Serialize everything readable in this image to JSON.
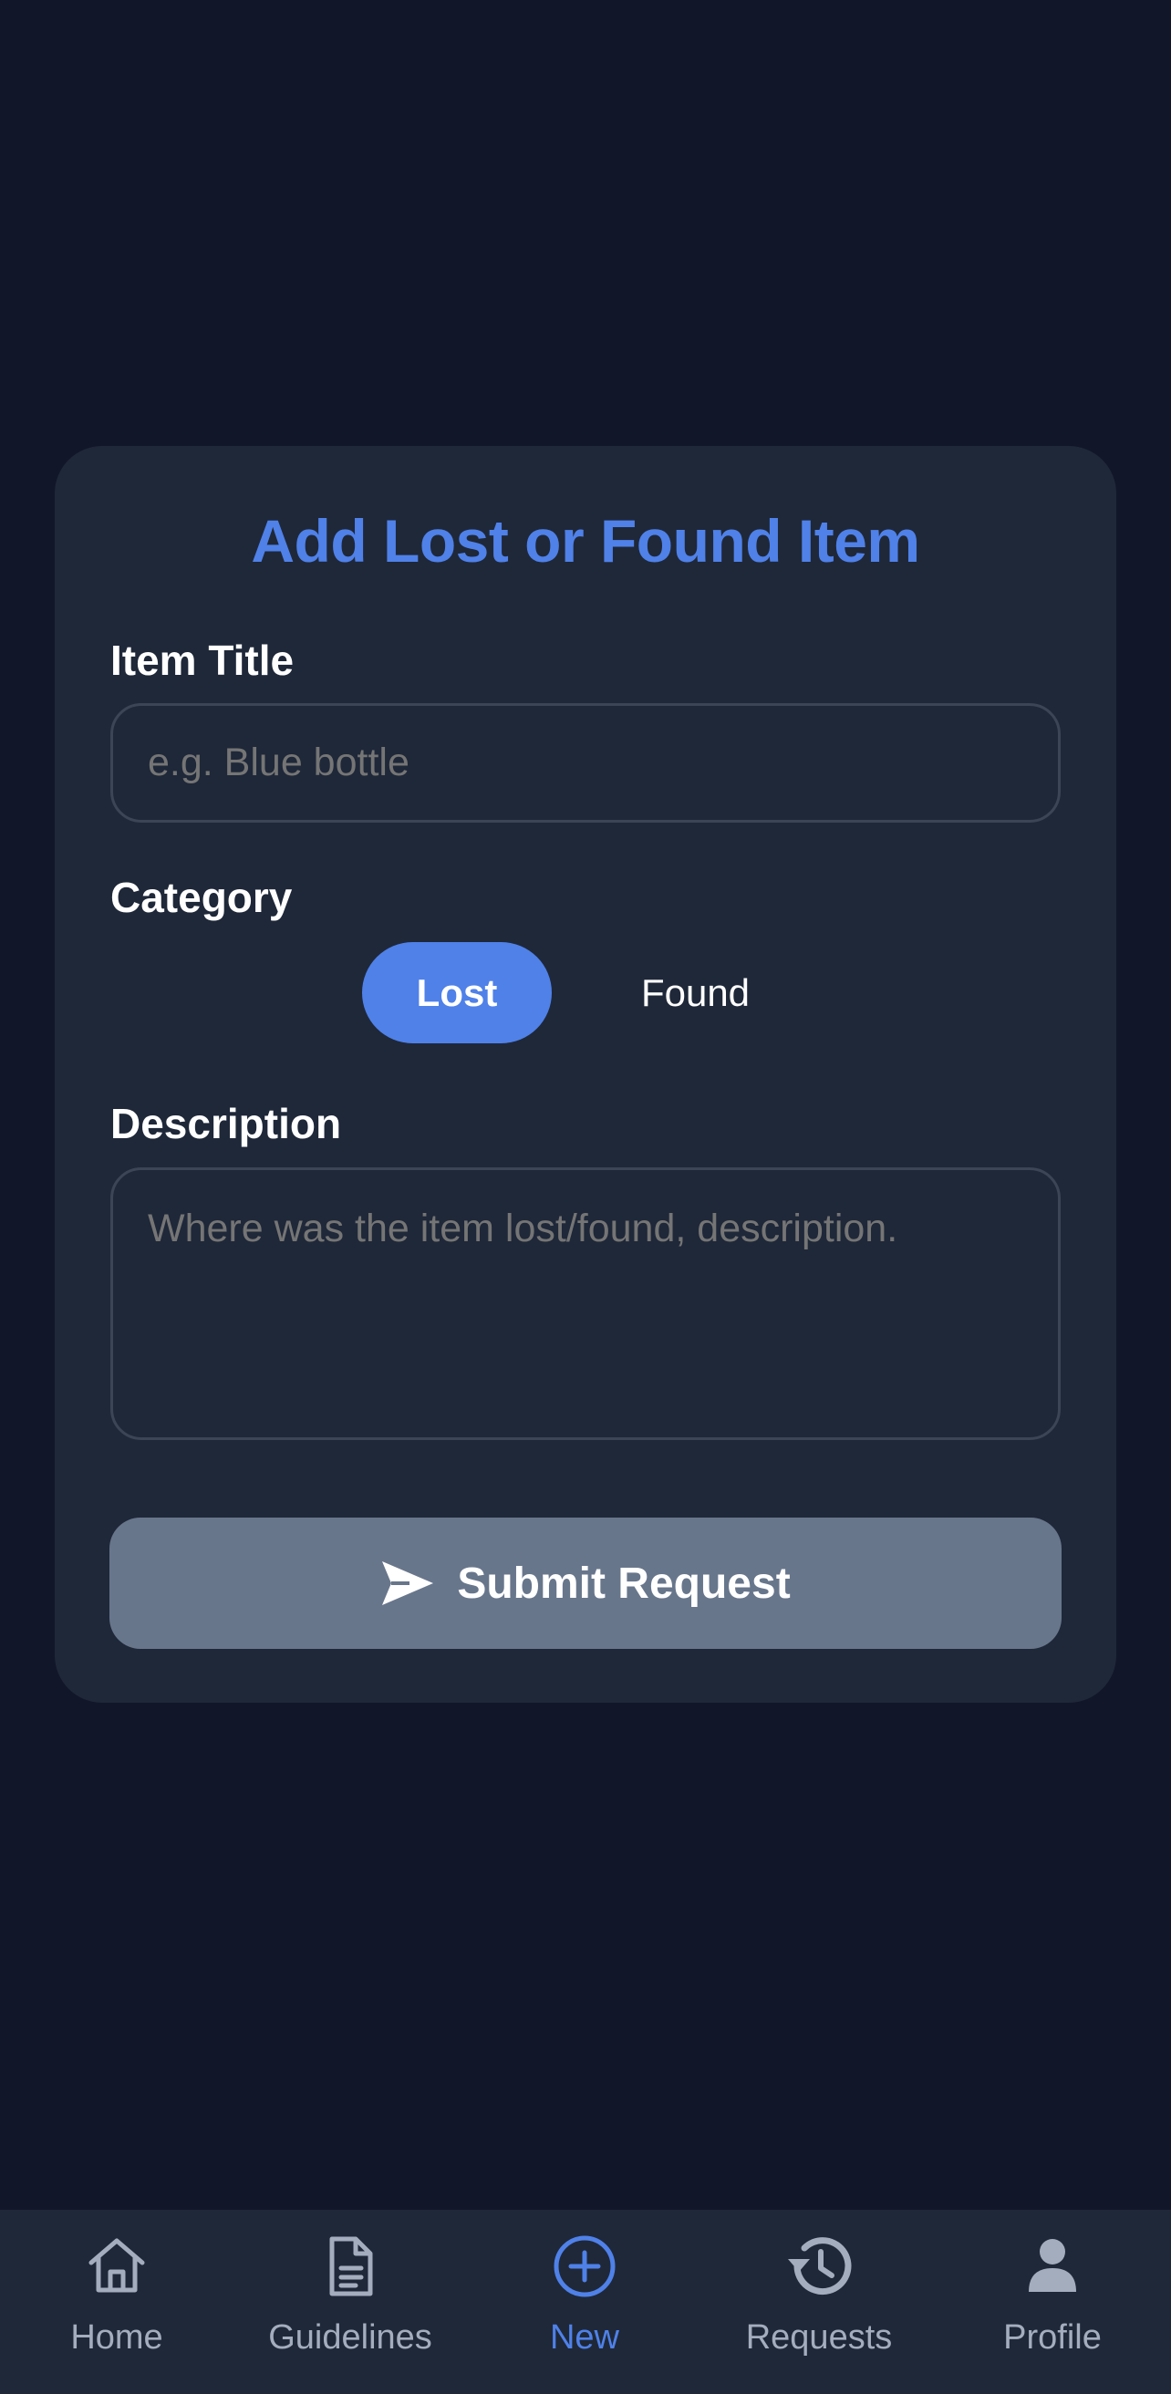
{
  "form": {
    "title": "Add Lost or Found Item",
    "item_title_label": "Item Title",
    "item_title_placeholder": "e.g. Blue bottle",
    "category_label": "Category",
    "category_options": [
      "Lost",
      "Found"
    ],
    "category_selected": "Lost",
    "description_label": "Description",
    "description_placeholder": "Where was the item lost/found, description.",
    "submit_label": "Submit Request"
  },
  "tabbar": {
    "items": [
      {
        "label": "Home",
        "icon": "home-icon"
      },
      {
        "label": "Guidelines",
        "icon": "document-icon"
      },
      {
        "label": "New",
        "icon": "plus-circle-icon"
      },
      {
        "label": "Requests",
        "icon": "history-icon"
      },
      {
        "label": "Profile",
        "icon": "user-icon"
      }
    ],
    "active": "New"
  },
  "colors": {
    "background": "#111729",
    "card": "#1f2839",
    "accent": "#4f81e8",
    "submit_disabled": "#68768c",
    "inactive_tab": "#a3adbe"
  }
}
